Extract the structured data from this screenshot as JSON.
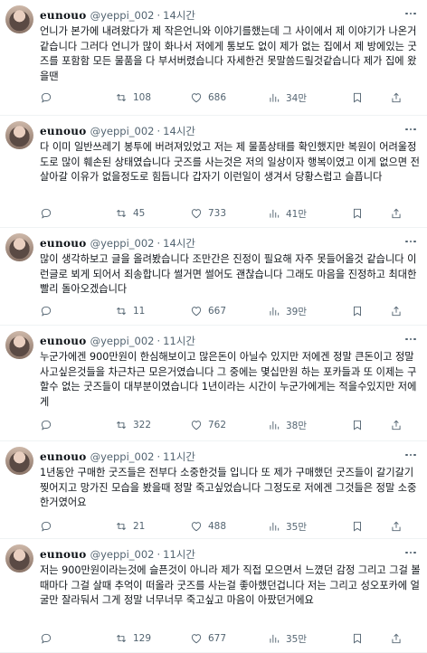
{
  "tweets": [
    {
      "name": "eunouo",
      "handle": "@yeppi_002",
      "dot": "·",
      "time": "14시간",
      "text": "언니가 본가에 내려왔다가 제 작은언니와 이야기를했는데 그 사이에서 제 이야기가 나온거같습니다 그러다 언니가 많이 화나서 저에게 통보도 없이 제가 없는 집에서 제 방에있는 굿즈를 포함함 모든 물품을 다 부서버렸습니다 자세한건 못말씀드릴것같습니다 제가 집에 왔을땐",
      "retweets": "",
      "likes": "108",
      "views": "686",
      "bytes": "34만"
    },
    {
      "name": "eunouo",
      "handle": "@yeppi_002",
      "dot": "·",
      "time": "14시간",
      "text": "다 이미 일반쓰레기 봉투에 버려져있었고 저는 제 물품상태를 확인했지만 복원이 어려울정도로 많이 훼손된 상태였습니다 굿즈를 사는것은 저의 일상이자 행복이였고 이게 없으면 전 살아갈 이유가 없을정도로 힘듭니다 갑자기 이런일이 생겨서 당황스럽고 슬픕니다",
      "retweets": "",
      "likes": "45",
      "views": "733",
      "bytes": "41만"
    },
    {
      "name": "eunouo",
      "handle": "@yeppi_002",
      "dot": "·",
      "time": "14시간",
      "text": "많이 생각하보고 글을 올려봤습니다 조만간은 진정이 필요해 자주 못들어올것 같습니다 이런글로 뵈게 되어서 죄송합니다 썰거면 썰어도 괜찮습니다 그래도 마음을 진정하고 최대한 빨리 돌아오겠습니다",
      "retweets": "",
      "likes": "11",
      "views": "667",
      "bytes": "39만"
    },
    {
      "name": "eunouo",
      "handle": "@yeppi_002",
      "dot": "·",
      "time": "11시간",
      "text": "누군가에겐 900만원이 한심해보이고 많은돈이 아닐수 있지만 저에겐 정말 큰돈이고 정말 사고싶은것들을 차근차근 모은거였습니다 그 중에는 몇십만원 하는 포카들과 또 이제는 구할수 없는 굿즈들이 대부분이였습니다 1년이라는 시간이 누군가에게는 적을수있지만 저에게",
      "retweets": "",
      "likes": "322",
      "views": "762",
      "bytes": "38만"
    },
    {
      "name": "eunouo",
      "handle": "@yeppi_002",
      "dot": "·",
      "time": "11시간",
      "text": "1년동안 구매한 굿즈들은 전부다 소중한것들 입니다 또 제가 구매했던 굿즈들이 갈기갈기 찢어지고 망가진 모습을 봤을때 정말 죽고싶었습니다 그정도로 저에겐 그것들은 정말 소중한거였어요",
      "retweets": "",
      "likes": "21",
      "views": "488",
      "bytes": "35만"
    },
    {
      "name": "eunouo",
      "handle": "@yeppi_002",
      "dot": "·",
      "time": "11시간",
      "text": "저는 900만원이라는것에 슬픈것이 아니라 제가 직접 모으면서 느꼈던 감정 그리고 그걸 볼때마다 그걸 살때 추억이 떠올라 굿즈를 사는걸 좋아했던겁니다 저는 그리고 성오포카에 얼굴만 잘라둬서 그게 정말 너무너무 죽고싶고 마음이 아팠던거에요",
      "retweets": "",
      "likes": "129",
      "views": "677",
      "bytes": "35만"
    }
  ]
}
